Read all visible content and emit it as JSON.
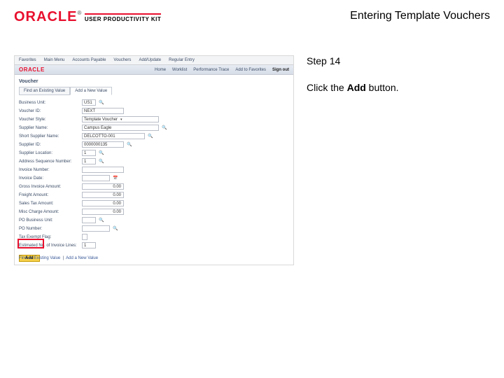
{
  "header": {
    "brand": "ORACLE",
    "tm": "®",
    "sub": "USER PRODUCTIVITY KIT",
    "lesson_title": "Entering Template Vouchers"
  },
  "instruction": {
    "step_label": "Step 14",
    "text_pre": "Click the ",
    "text_bold": "Add",
    "text_post": " button."
  },
  "shot": {
    "topbar": {
      "items": [
        "Favorites",
        "Main Menu",
        "Accounts Payable",
        "Vouchers",
        "Add/Update",
        "Regular Entry"
      ]
    },
    "brandbar": {
      "logo": "ORACLE",
      "nav": [
        "Home",
        "Worklist",
        "Performance Trace",
        "Add to Favorites",
        "Sign out"
      ]
    },
    "section_title": "Voucher",
    "tabs": {
      "left": "Find an Existing Value",
      "right": "Add a New Value"
    },
    "form": [
      {
        "label": "Business Unit:",
        "value": "US1",
        "w": "w20",
        "lookup": true
      },
      {
        "label": "Voucher ID:",
        "value": "NEXT",
        "w": "w60"
      },
      {
        "label": "Voucher Style:",
        "value": "Template Voucher",
        "type": "select",
        "w": "w110"
      },
      {
        "label": "Supplier Name:",
        "value": "Campus Eagle",
        "w": "w110",
        "lookup": true
      },
      {
        "label": "Short Supplier Name:",
        "value": "DELCOTTO-001",
        "w": "w90",
        "lookup": true
      },
      {
        "label": "Supplier ID:",
        "value": "0000000135",
        "w": "w60",
        "lookup": true
      },
      {
        "label": "Supplier Location:",
        "value": "1",
        "w": "w20",
        "lookup": true
      },
      {
        "label": "Address Sequence Number:",
        "value": "1",
        "w": "w20",
        "lookup": true
      },
      {
        "label": "Invoice Number:",
        "value": "",
        "w": "w60"
      },
      {
        "label": "Invoice Date:",
        "value": "",
        "w": "w40",
        "calendar": true
      },
      {
        "label": "Gross Invoice Amount:",
        "value": "0.00",
        "w": "w60",
        "num": true
      },
      {
        "label": "Freight Amount:",
        "value": "0.00",
        "w": "w60",
        "num": true
      },
      {
        "label": "Sales Tax Amount:",
        "value": "0.00",
        "w": "w60",
        "num": true
      },
      {
        "label": "Misc Charge Amount:",
        "value": "0.00",
        "w": "w60",
        "num": true
      },
      {
        "label": "PO Business Unit:",
        "value": "",
        "w": "w20",
        "lookup": true
      },
      {
        "label": "PO Number:",
        "value": "",
        "w": "w40",
        "lookup": true
      },
      {
        "label": "Tax Exempt Flag:",
        "value": "",
        "type": "checkbox"
      },
      {
        "label": "Estimated No. of Invoice Lines:",
        "value": "1",
        "w": "w20"
      }
    ],
    "add_label": "Add",
    "footer": {
      "left": "Find an Existing Value",
      "right": "Add a New Value"
    }
  }
}
